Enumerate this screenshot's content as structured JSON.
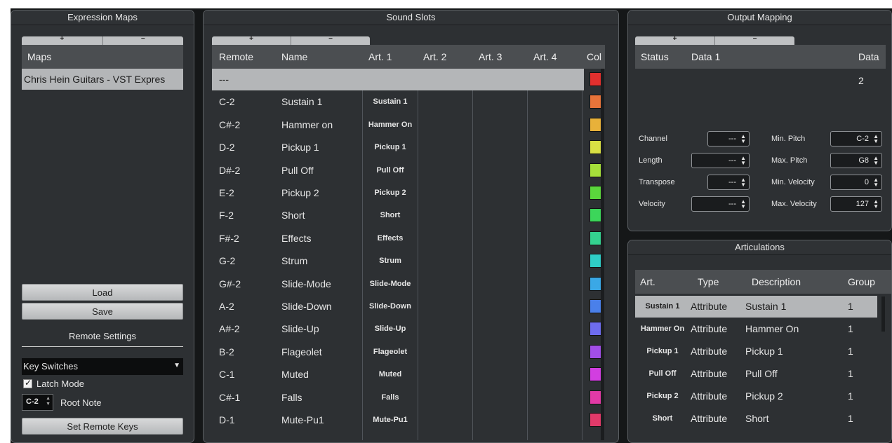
{
  "expression_maps": {
    "title": "Expression Maps",
    "add": "+",
    "remove": "−",
    "header": "Maps",
    "maps": [
      "Chris Hein Guitars - VST Expres"
    ],
    "load_label": "Load",
    "save_label": "Save",
    "remote_settings_title": "Remote Settings",
    "remote_mode": "Key Switches",
    "latch_mode_label": "Latch Mode",
    "latch_mode_checked": true,
    "root_note_value": "C-2",
    "root_note_label": "Root Note",
    "set_remote_keys_label": "Set Remote Keys"
  },
  "sound_slots": {
    "title": "Sound Slots",
    "add": "+",
    "remove": "−",
    "columns": [
      "Remote",
      "Name",
      "Art. 1",
      "Art. 2",
      "Art. 3",
      "Art. 4",
      "Col"
    ],
    "rows": [
      {
        "remote": "---",
        "name": "",
        "art1": "",
        "color": "#e2302e"
      },
      {
        "remote": "C-2",
        "name": "Sustain 1",
        "art1": "Sustain 1",
        "color": "#e8743a"
      },
      {
        "remote": "C#-2",
        "name": "Hammer on",
        "art1": "Hammer On",
        "color": "#e8b13a"
      },
      {
        "remote": "D-2",
        "name": "Pickup 1",
        "art1": "Pickup 1",
        "color": "#d9e044"
      },
      {
        "remote": "D#-2",
        "name": "Pull Off",
        "art1": "Pull Off",
        "color": "#a6e03a"
      },
      {
        "remote": "E-2",
        "name": "Pickup 2",
        "art1": "Pickup 2",
        "color": "#5bd63c"
      },
      {
        "remote": "F-2",
        "name": "Short",
        "art1": "Short",
        "color": "#3cd65a"
      },
      {
        "remote": "F#-2",
        "name": "Effects",
        "art1": "Effects",
        "color": "#34d18f"
      },
      {
        "remote": "G-2",
        "name": "Strum",
        "art1": "Strum",
        "color": "#2fcdc6"
      },
      {
        "remote": "G#-2",
        "name": "Slide-Mode",
        "art1": "Slide-Mode",
        "color": "#3aa8e6"
      },
      {
        "remote": "A-2",
        "name": "Slide-Down",
        "art1": "Slide-Down",
        "color": "#4a80ea"
      },
      {
        "remote": "A#-2",
        "name": "Slide-Up",
        "art1": "Slide-Up",
        "color": "#6e6cef"
      },
      {
        "remote": "B-2",
        "name": "Flageolet",
        "art1": "Flageolet",
        "color": "#a24ee8"
      },
      {
        "remote": "C-1",
        "name": "Muted",
        "art1": "Muted",
        "color": "#d23ee0"
      },
      {
        "remote": "C#-1",
        "name": "Falls",
        "art1": "Falls",
        "color": "#e23aa6"
      },
      {
        "remote": "D-1",
        "name": "Mute-Pu1",
        "art1": "Mute-Pu1",
        "color": "#e23a6a"
      }
    ]
  },
  "output_mapping": {
    "title": "Output Mapping",
    "add": "+",
    "remove": "−",
    "columns": [
      "Status",
      "Data 1",
      "Data 2"
    ],
    "fields": {
      "channel": {
        "label": "Channel",
        "value": "---"
      },
      "length": {
        "label": "Length",
        "value": "---"
      },
      "transpose": {
        "label": "Transpose",
        "value": "---"
      },
      "velocity": {
        "label": "Velocity",
        "value": "---"
      },
      "min_pitch": {
        "label": "Min. Pitch",
        "value": "C-2"
      },
      "max_pitch": {
        "label": "Max. Pitch",
        "value": "G8"
      },
      "min_velocity": {
        "label": "Min. Velocity",
        "value": "0"
      },
      "max_velocity": {
        "label": "Max. Velocity",
        "value": "127"
      }
    }
  },
  "articulations": {
    "title": "Articulations",
    "columns": [
      "Art.",
      "Type",
      "Description",
      "Group"
    ],
    "rows": [
      {
        "art": "Sustain 1",
        "type": "Attribute",
        "description": "Sustain 1",
        "group": "1"
      },
      {
        "art": "Hammer On",
        "type": "Attribute",
        "description": "Hammer On",
        "group": "1"
      },
      {
        "art": "Pickup 1",
        "type": "Attribute",
        "description": "Pickup 1",
        "group": "1"
      },
      {
        "art": "Pull Off",
        "type": "Attribute",
        "description": "Pull Off",
        "group": "1"
      },
      {
        "art": "Pickup 2",
        "type": "Attribute",
        "description": "Pickup 2",
        "group": "1"
      },
      {
        "art": "Short",
        "type": "Attribute",
        "description": "Short",
        "group": "1"
      }
    ]
  }
}
